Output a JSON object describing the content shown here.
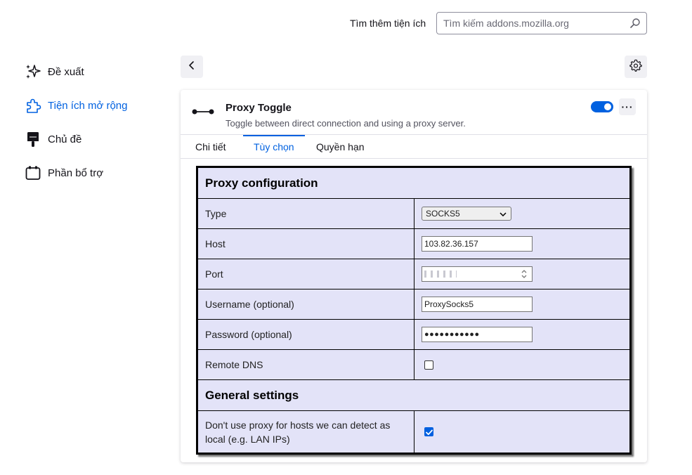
{
  "header": {
    "search_label": "Tìm thêm tiện ích",
    "search_placeholder": "Tìm kiếm addons.mozilla.org"
  },
  "sidebar": {
    "items": [
      {
        "label": "Đề xuất",
        "icon": "sparkle-icon"
      },
      {
        "label": "Tiện ích mở rộng",
        "icon": "puzzle-icon",
        "active": true
      },
      {
        "label": "Chủ đề",
        "icon": "brush-icon"
      },
      {
        "label": "Phần bổ trợ",
        "icon": "plugin-icon"
      }
    ]
  },
  "addon": {
    "name": "Proxy Toggle",
    "description": "Toggle between direct connection and using a proxy server.",
    "enabled": true,
    "more_label": "···",
    "tabs": [
      "Chi tiết",
      "Tùy chọn",
      "Quyền hạn"
    ],
    "selected_tab": "Tùy chọn"
  },
  "options": {
    "proxy_heading": "Proxy configuration",
    "type_label": "Type",
    "type_value": "SOCKS5",
    "host_label": "Host",
    "host_value": "103.82.36.157",
    "port_label": "Port",
    "username_label": "Username (optional)",
    "username_value": "ProxySocks5",
    "password_label": "Password (optional)",
    "password_value": "●●●●●●●●●●●",
    "remote_dns_label": "Remote DNS",
    "remote_dns_checked": false,
    "general_heading": "General settings",
    "local_label": "Don't use proxy for hosts we can detect as local (e.g. LAN IPs)",
    "local_checked": true
  },
  "colors": {
    "accent": "#0061e0",
    "options_bg": "#e3e3f8"
  }
}
